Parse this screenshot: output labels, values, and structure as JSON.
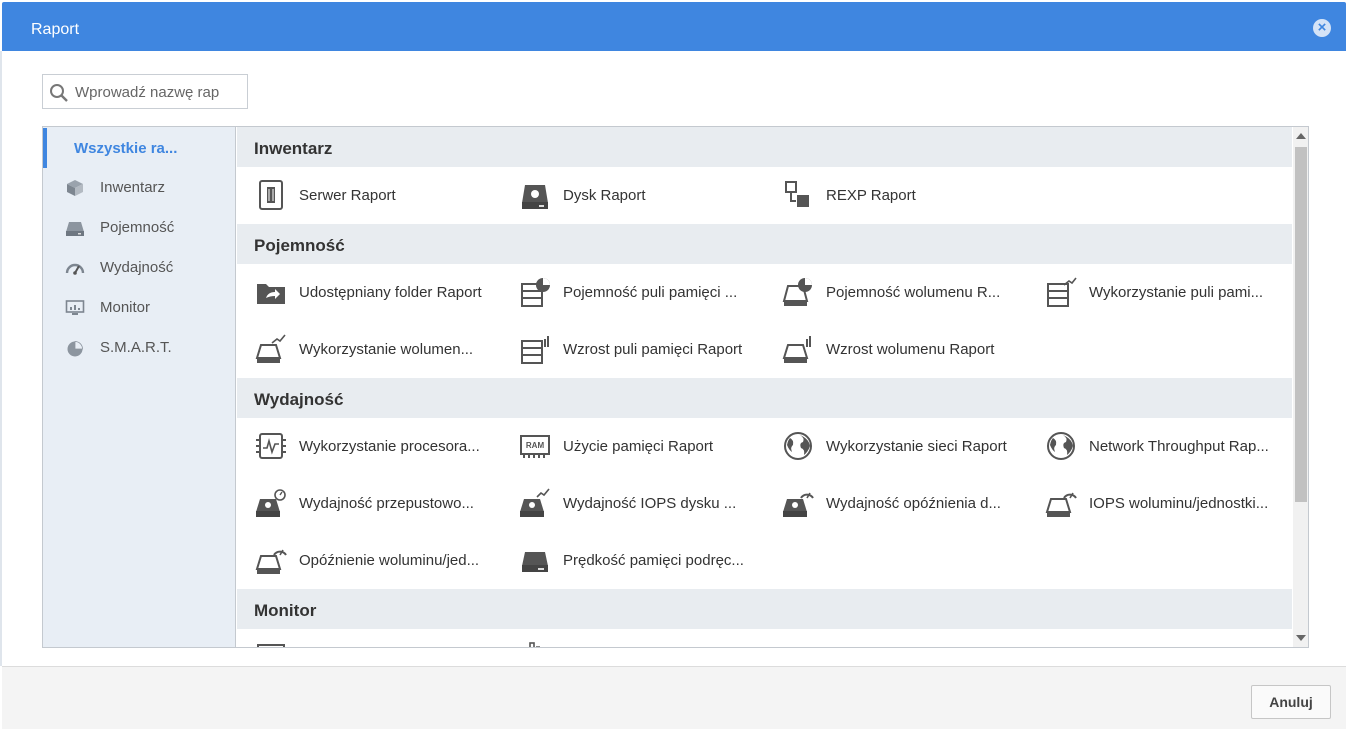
{
  "dialog": {
    "title": "Raport"
  },
  "search": {
    "placeholder": "Wprowadź nazwę rap"
  },
  "sidebar": {
    "items": [
      {
        "label": "Wszystkie ra...",
        "active": true
      },
      {
        "label": "Inwentarz",
        "icon": "cube-icon"
      },
      {
        "label": "Pojemność",
        "icon": "drive-icon"
      },
      {
        "label": "Wydajność",
        "icon": "gauge-icon"
      },
      {
        "label": "Monitor",
        "icon": "monitor-icon"
      },
      {
        "label": "S.M.A.R.T.",
        "icon": "pie-icon"
      }
    ]
  },
  "sections": [
    {
      "title": "Inwentarz",
      "items": [
        {
          "label": "Serwer Raport",
          "icon": "server-icon"
        },
        {
          "label": "Dysk Raport",
          "icon": "disk-icon"
        },
        {
          "label": "REXP Raport",
          "icon": "rexp-icon"
        }
      ]
    },
    {
      "title": "Pojemność",
      "items": [
        {
          "label": "Udostępniany folder Raport",
          "icon": "shared-folder-icon"
        },
        {
          "label": "Pojemność puli pamięci ...",
          "icon": "pool-capacity-icon"
        },
        {
          "label": "Pojemność wolumenu R...",
          "icon": "volume-capacity-icon"
        },
        {
          "label": "Wykorzystanie puli pami...",
          "icon": "pool-usage-icon"
        },
        {
          "label": "Wykorzystanie wolumen...",
          "icon": "volume-usage-icon"
        },
        {
          "label": "Wzrost puli pamięci Raport",
          "icon": "pool-growth-icon"
        },
        {
          "label": "Wzrost wolumenu Raport",
          "icon": "volume-growth-icon"
        }
      ]
    },
    {
      "title": "Wydajność",
      "items": [
        {
          "label": "Wykorzystanie procesora...",
          "icon": "cpu-icon"
        },
        {
          "label": "Użycie pamięci Raport",
          "icon": "ram-icon"
        },
        {
          "label": "Wykorzystanie sieci Raport",
          "icon": "globe-icon"
        },
        {
          "label": "Network Throughput Rap...",
          "icon": "globe-icon"
        },
        {
          "label": "Wydajność przepustowo...",
          "icon": "disk-throughput-icon"
        },
        {
          "label": "Wydajność IOPS dysku ...",
          "icon": "disk-iops-icon"
        },
        {
          "label": "Wydajność opóźnienia d...",
          "icon": "disk-latency-icon"
        },
        {
          "label": "IOPS woluminu/jednostki...",
          "icon": "volume-iops-icon"
        },
        {
          "label": "Opóźnienie woluminu/jed...",
          "icon": "volume-latency-icon"
        },
        {
          "label": "Prędkość pamięci podręc...",
          "icon": "cache-icon"
        }
      ]
    },
    {
      "title": "Monitor",
      "items": []
    }
  ],
  "footer": {
    "cancel_label": "Anuluj"
  }
}
